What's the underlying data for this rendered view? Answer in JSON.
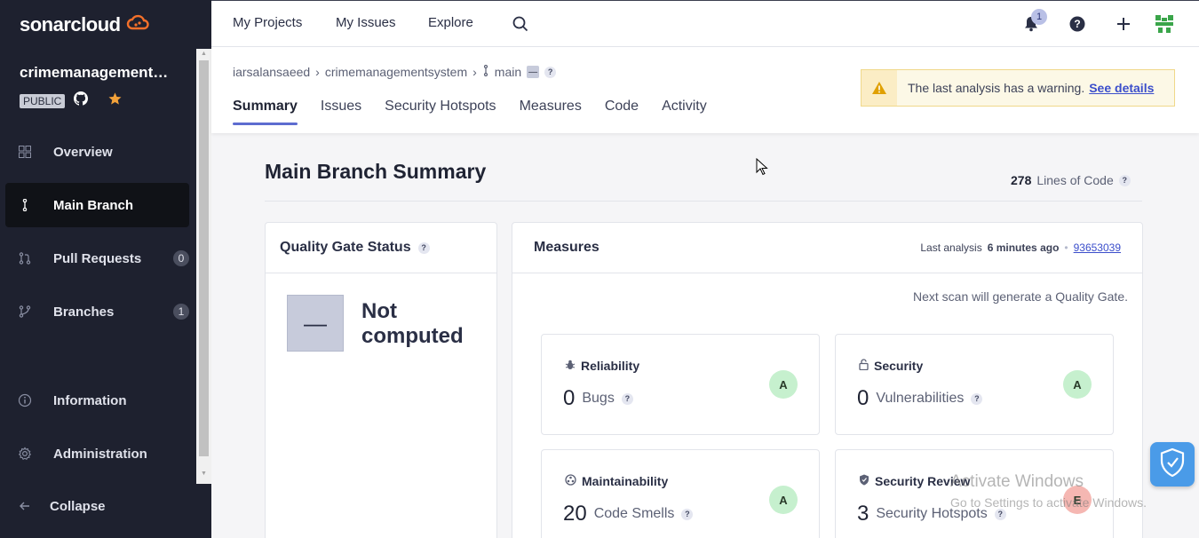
{
  "brand": {
    "name": "sonarcloud",
    "icon": "cloud-logo-icon",
    "color": "#f3702a"
  },
  "project": {
    "name": "crimemanagements...",
    "visibility": "PUBLIC"
  },
  "sidebar": {
    "items": [
      {
        "label": "Overview",
        "icon": "grid-icon"
      },
      {
        "label": "Main Branch",
        "icon": "branch-icon",
        "active": true
      },
      {
        "label": "Pull Requests",
        "icon": "pull-request-icon",
        "count": "0"
      },
      {
        "label": "Branches",
        "icon": "branches-icon",
        "count": "1"
      },
      {
        "label": "Information",
        "icon": "info-icon"
      },
      {
        "label": "Administration",
        "icon": "gear-icon"
      }
    ],
    "collapse_label": "Collapse"
  },
  "topbar": {
    "links": [
      "My Projects",
      "My Issues",
      "Explore"
    ],
    "notification_count": "1"
  },
  "breadcrumb": {
    "org": "iarsalansaeed",
    "project": "crimemanagementsystem",
    "branch": "main",
    "branch_badge": "—",
    "help": "?"
  },
  "tabs": [
    "Summary",
    "Issues",
    "Security Hotspots",
    "Measures",
    "Code",
    "Activity"
  ],
  "warning": {
    "text": "The last analysis has a warning.",
    "link": "See details"
  },
  "summary": {
    "title": "Main Branch Summary",
    "loc_value": "278",
    "loc_label": "Lines of Code",
    "help": "?"
  },
  "quality_gate": {
    "title": "Quality Gate Status",
    "help": "?",
    "box_symbol": "—",
    "status": "Not computed"
  },
  "measures": {
    "title": "Measures",
    "last_analysis_label": "Last analysis",
    "last_analysis_time": "6 minutes ago",
    "version": "93653039",
    "next_scan": "Next scan will generate a Quality Gate.",
    "cards": [
      {
        "title": "Reliability",
        "icon": "bug-icon",
        "value": "0",
        "unit": "Bugs",
        "help": "?",
        "rating": "A",
        "rating_color": "#c6f0ce"
      },
      {
        "title": "Security",
        "icon": "lock-icon",
        "value": "0",
        "unit": "Vulnerabilities",
        "help": "?",
        "rating": "A",
        "rating_color": "#c6f0ce"
      },
      {
        "title": "Maintainability",
        "icon": "maintainability-icon",
        "value": "20",
        "unit": "Code Smells",
        "help": "?",
        "rating": "A",
        "rating_color": "#c6f0ce"
      },
      {
        "title": "Security Review",
        "icon": "shield-icon",
        "value": "3",
        "unit": "Security Hotspots",
        "help": "?",
        "rating": "E",
        "rating_color": "#f5b7b2"
      }
    ]
  },
  "watermark": {
    "line1": "Activate Windows",
    "line2": "Go to Settings to activate Windows."
  }
}
